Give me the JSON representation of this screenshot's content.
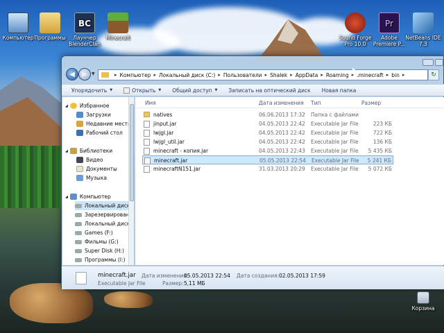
{
  "desktop": {
    "icons": [
      {
        "label": "Компьютер"
      },
      {
        "label": "Программы"
      },
      {
        "label": "Лаунчер BlenderClan"
      },
      {
        "label": "Minecraft"
      },
      {
        "label": "Sound Forge Pro 10.0"
      },
      {
        "label": "Adobe Premiere P..."
      },
      {
        "label": "NetBeans IDE 7.3"
      },
      {
        "label": "Корзина"
      }
    ]
  },
  "explorer": {
    "address": {
      "crumbs": [
        "Компьютер",
        "Локальный диск (C:)",
        "Пользователи",
        "Shalek",
        "AppData",
        "Roaming",
        ".minecraft",
        "bin"
      ]
    },
    "toolbar": {
      "organize": "Упорядочить",
      "open": "Открыть",
      "share": "Общий доступ",
      "burn": "Записать на оптический диск",
      "new_folder": "Новая папка"
    },
    "sidebar": {
      "favorites": "Избранное",
      "downloads": "Загрузки",
      "recent": "Недавние места",
      "desktop": "Рабочий стол",
      "libraries": "Библиотеки",
      "video": "Видео",
      "documents": "Документы",
      "music": "Музыка",
      "computer": "Компьютер",
      "drives": [
        "Локальный диск",
        "Зарезервирован",
        "Локальный диск",
        "Games (F:)",
        "Фильмы (G:)",
        "Super Disk (H:)",
        "Программы (I:)"
      ]
    },
    "columns": {
      "name": "Имя",
      "modified": "Дата изменения",
      "type": "Тип",
      "size": "Размер"
    },
    "files": [
      {
        "name": "natives",
        "modified": "06.06.2013 17:32",
        "type": "Папка с файлами",
        "size": "",
        "kind": "folder"
      },
      {
        "name": "jinput.jar",
        "modified": "04.05.2013 22:42",
        "type": "Executable Jar File",
        "size": "223 КБ",
        "kind": "jar"
      },
      {
        "name": "lwjgl.jar",
        "modified": "04.05.2013 22:42",
        "type": "Executable Jar File",
        "size": "722 КБ",
        "kind": "jar"
      },
      {
        "name": "lwjgl_util.jar",
        "modified": "04.05.2013 22:42",
        "type": "Executable Jar File",
        "size": "136 КБ",
        "kind": "jar"
      },
      {
        "name": "minecraft - копия.jar",
        "modified": "04.05.2013 22:43",
        "type": "Executable Jar File",
        "size": "5 435 КБ",
        "kind": "jar"
      },
      {
        "name": "minecraft.jar",
        "modified": "05.05.2013 22:54",
        "type": "Executable Jar File",
        "size": "5 241 КБ",
        "kind": "jar",
        "selected": true
      },
      {
        "name": "minecraftN151.jar",
        "modified": "31.03.2013 20:29",
        "type": "Executable Jar File",
        "size": "5 072 КБ",
        "kind": "jar"
      }
    ],
    "details": {
      "filename": "minecraft.jar",
      "filetype": "Executable Jar File",
      "modified_label": "Дата изменения:",
      "modified_value": "05.05.2013 22:54",
      "created_label": "Дата создания:",
      "created_value": "02.05.2013 17:59",
      "size_label": "Размер:",
      "size_value": "5,11 МБ"
    }
  }
}
